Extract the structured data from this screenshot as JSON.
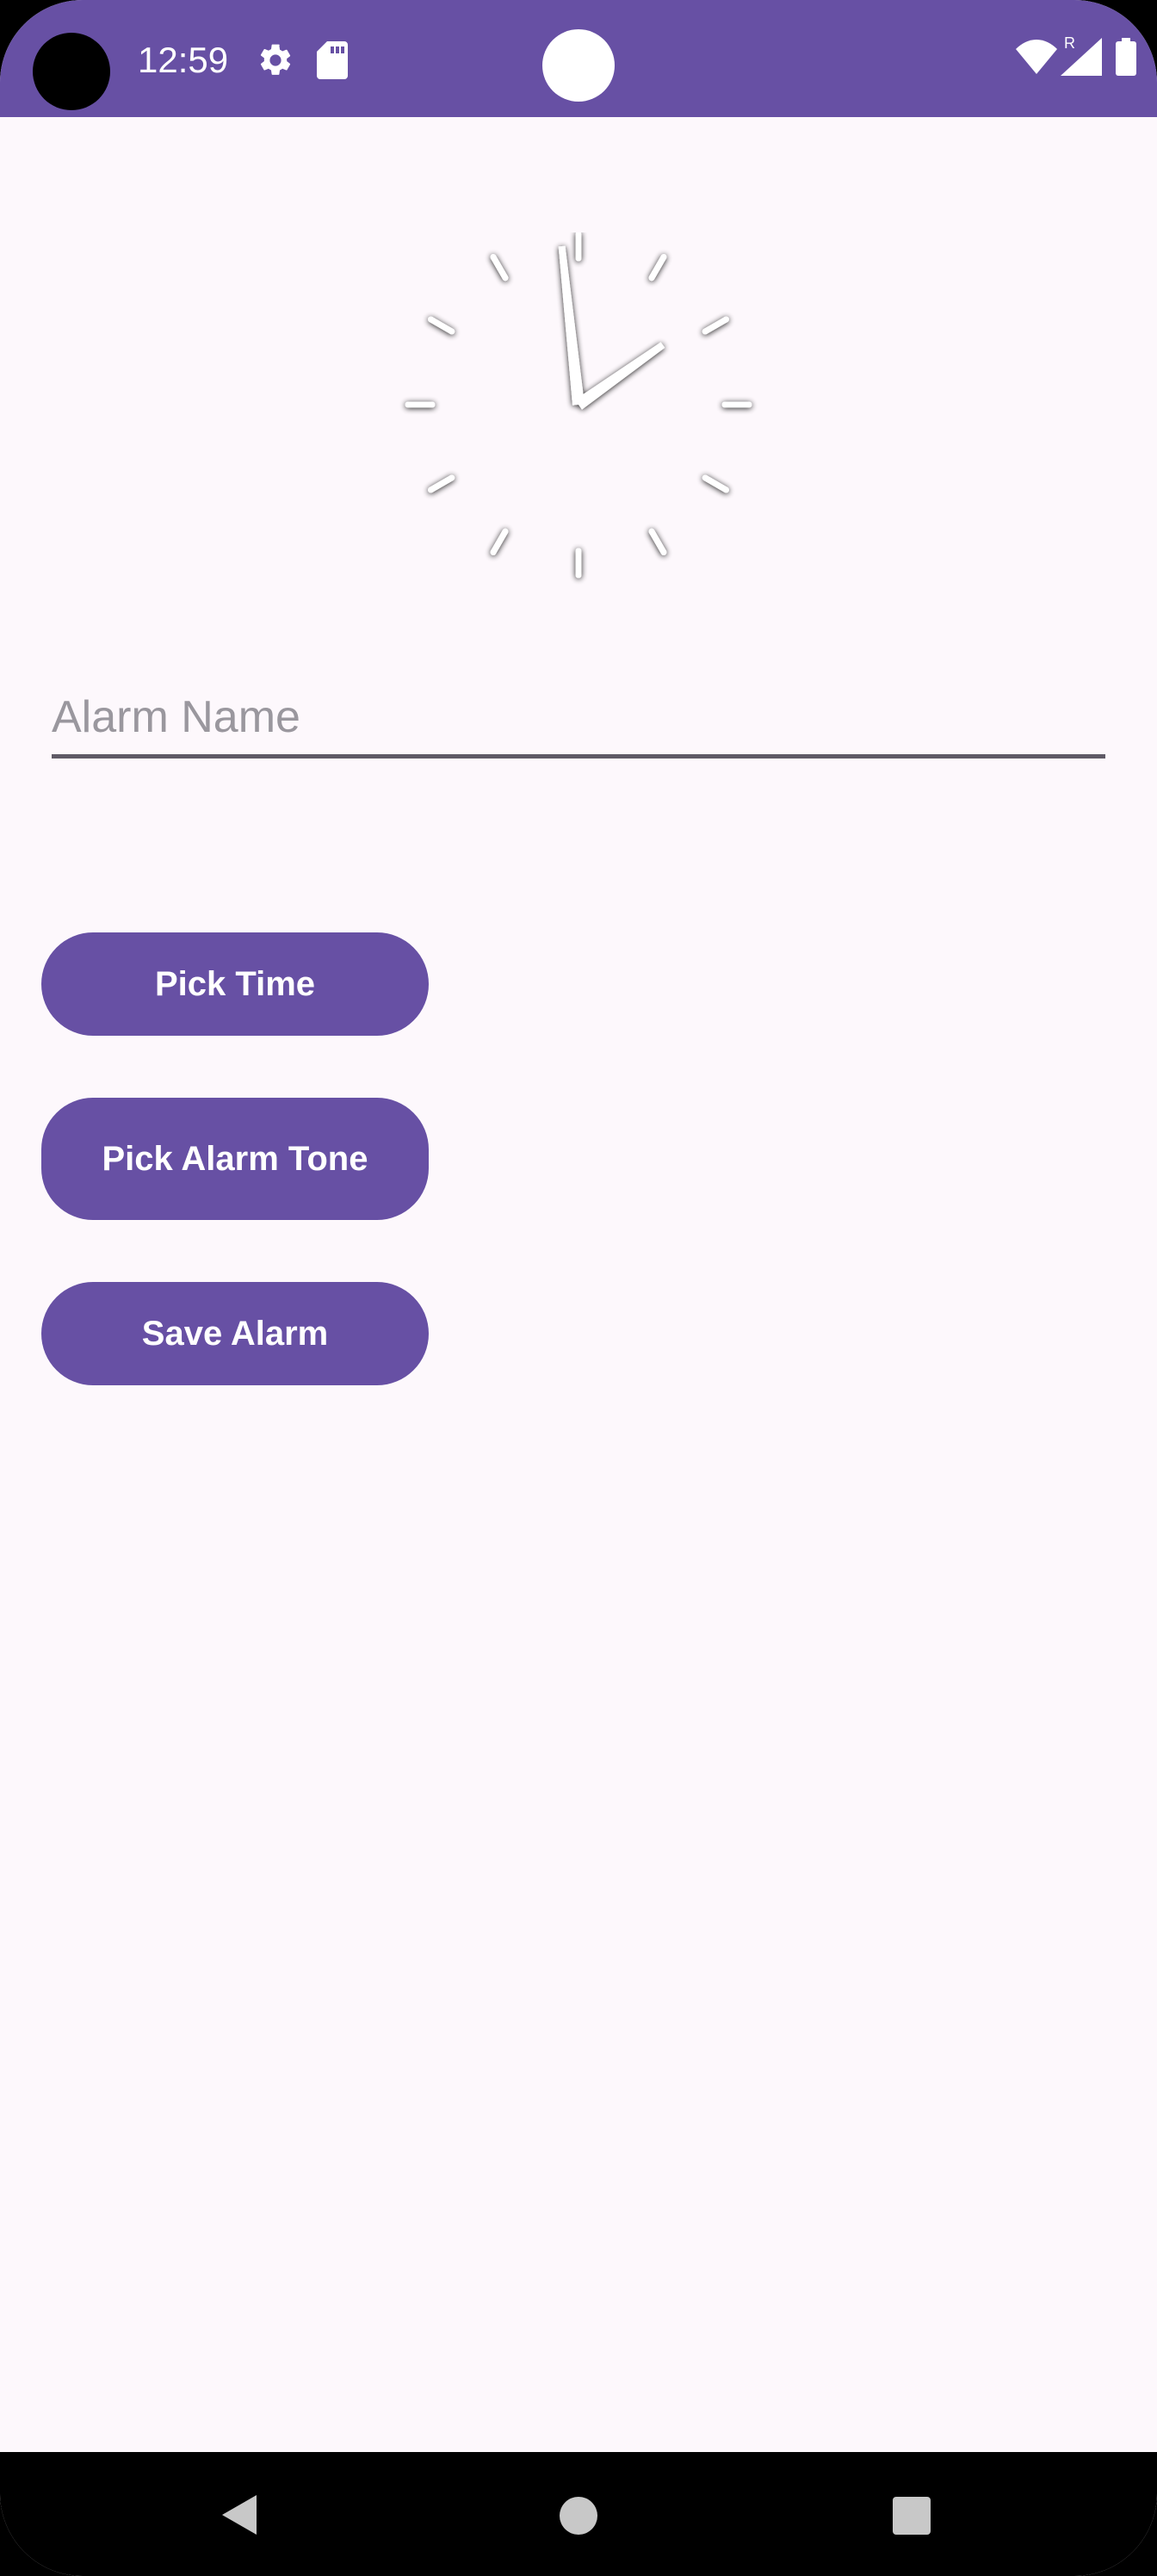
{
  "status_bar": {
    "time": "12:59",
    "icons": [
      "gear-icon",
      "sd-card-icon",
      "wifi-icon",
      "signal-icon",
      "battery-icon"
    ],
    "roaming_label": "R"
  },
  "clock": {
    "hour": 12,
    "minute": 59
  },
  "form": {
    "alarm_name_placeholder": "Alarm Name",
    "alarm_name_value": ""
  },
  "buttons": {
    "pick_time": "Pick Time",
    "pick_alarm_tone": "Pick Alarm Tone",
    "save_alarm": "Save Alarm"
  },
  "nav_bar": {
    "icons": [
      "back-icon",
      "home-icon",
      "recents-icon"
    ]
  },
  "colors": {
    "primary": "#6750A4",
    "background": "#FDF8FC",
    "on_primary": "#FFFFFF"
  }
}
